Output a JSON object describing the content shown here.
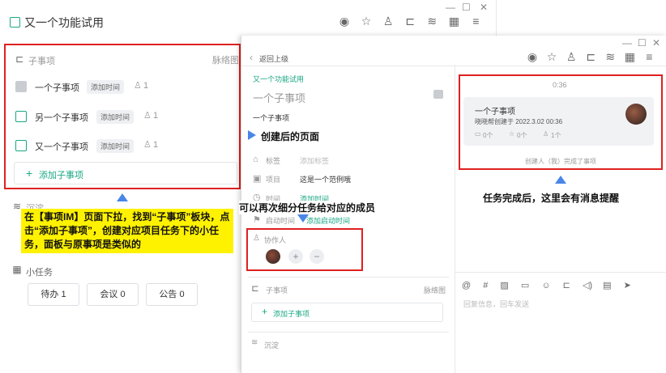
{
  "main_window": {
    "title": "又一个功能试用",
    "controls": [
      "—",
      "☐",
      "✕"
    ]
  },
  "subtasks_panel": {
    "header": "子事项",
    "view_link": "脉络图",
    "items": [
      {
        "label": "一个子事项",
        "tag": "添加时间",
        "count": "1",
        "done": true
      },
      {
        "label": "另一个子事项",
        "tag": "添加时间",
        "count": "1",
        "done": false
      },
      {
        "label": "又一个子事项",
        "tag": "添加时间",
        "count": "1",
        "done": false
      }
    ],
    "add_label": "添加子事项"
  },
  "left_note": "在【事项IM】页面下拉，找到“子事项”板块，点击“添加子事项”，创建对应项目任务下的小任务，面板与原事项是类似的",
  "left_partial_label": "沉淀",
  "small_tasks": {
    "header": "小任务",
    "buttons": [
      "待办 1",
      "会议 0",
      "公告 0"
    ]
  },
  "detail": {
    "back_label": "返回上级",
    "parent_link": "又一个功能试用",
    "title": "一个子事项",
    "subtitle": "一个子事项",
    "fields": {
      "tag_label": "标签",
      "tag_value": "添加标签",
      "project_label": "项目",
      "project_value": "这是一个范例哦",
      "time_label": "时间",
      "time_value": "添加时间",
      "start_label": "启动时间",
      "start_value": "添加启动时间"
    },
    "collab_label": "协作人",
    "subtasks_header": "子事项",
    "subtasks_view": "脉络图",
    "add_subtask": "添加子事项",
    "footer_label": "沉淀"
  },
  "callouts": {
    "created": "创建后的页面",
    "assign": "可以再次细分任务给对应的成员",
    "notify": "任务完成后，这里会有消息提醒"
  },
  "chat": {
    "time": "0:36",
    "card_title": "一个子事项",
    "card_meta": "晓晓帮创建于 2022.3.02 00:36",
    "card_stats": [
      "0个",
      "0个",
      "1个"
    ],
    "system_msg": "创建人（我）完成了事项",
    "input_placeholder": "回复信息，回车发送"
  }
}
